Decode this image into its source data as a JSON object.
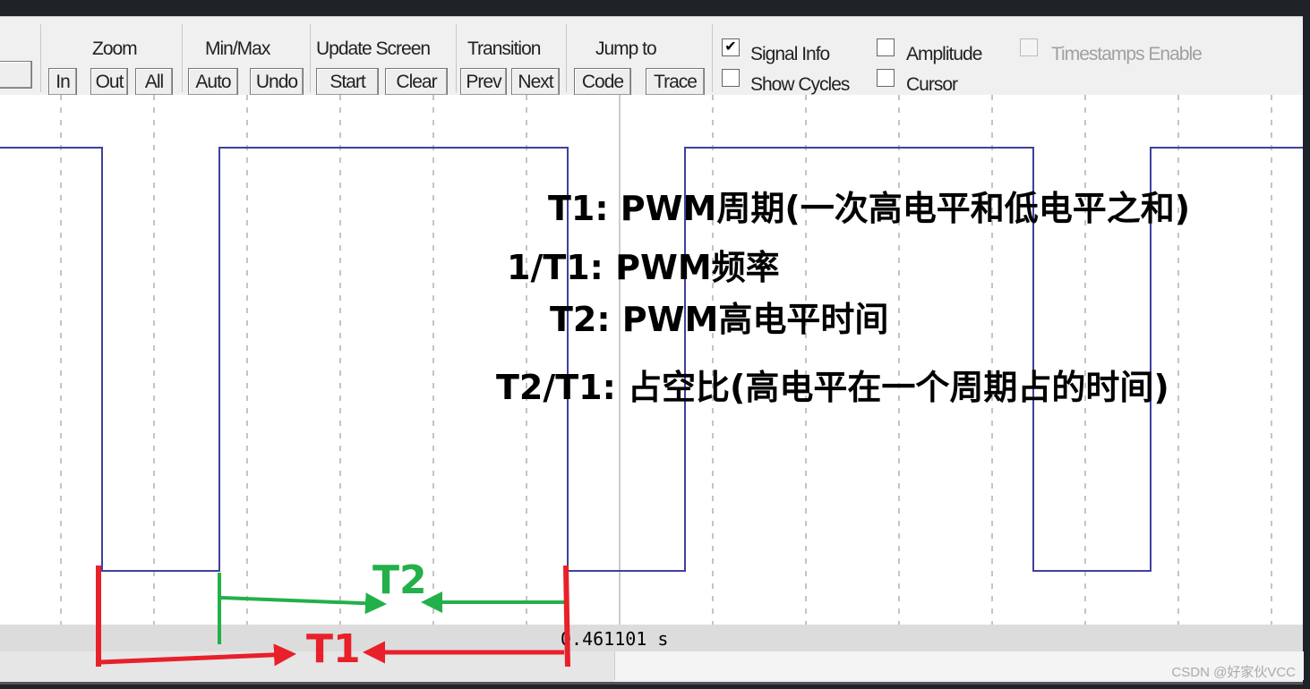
{
  "toolbar": {
    "zoom": {
      "label": "Zoom",
      "in": "In",
      "out": "Out",
      "all": "All"
    },
    "minmax": {
      "label": "Min/Max",
      "auto": "Auto",
      "undo": "Undo"
    },
    "update": {
      "label": "Update Screen",
      "start": "Start",
      "clear": "Clear"
    },
    "transition": {
      "label": "Transition",
      "prev": "Prev",
      "next": "Next"
    },
    "jump": {
      "label": "Jump to",
      "code": "Code",
      "trace": "Trace"
    },
    "options": {
      "signal_info": {
        "label": "Signal Info",
        "checked": true
      },
      "show_cycles": {
        "label": "Show Cycles",
        "checked": false
      },
      "amplitude": {
        "label": "Amplitude",
        "checked": false
      },
      "cursor": {
        "label": "Cursor",
        "checked": false
      },
      "timestamps": {
        "label": "Timestamps Enable",
        "checked": false,
        "disabled": true
      }
    }
  },
  "annotations": {
    "t1": "T1:   PWM周期(一次高电平和低电平之和)",
    "freq": "1/T1:  PWM频率",
    "t2": "T2:   PWM高电平时间",
    "duty": "T2/T1:  占空比(高电平在一个周期占的时间)",
    "t2_marker": "T2",
    "t1_marker": "T1"
  },
  "status": {
    "time": "0.461101 s"
  },
  "watermark": "CSDN @好家伙VCC",
  "colors": {
    "signal": "#4040a0",
    "t1": "#e8202a",
    "t2": "#22b04a"
  }
}
